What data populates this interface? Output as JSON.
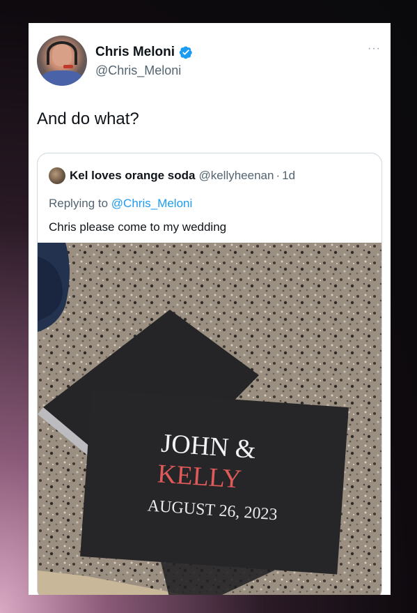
{
  "tweet": {
    "author_name": "Chris Meloni",
    "author_handle": "@Chris_Meloni",
    "more_label": "···",
    "text": "And do what?"
  },
  "quoted": {
    "author_name": "Kel loves orange soda",
    "author_handle": "@kellyheenan",
    "separator": "·",
    "time": "1d",
    "replying_prefix": "Replying to",
    "replying_mention": "@Chris_Meloni",
    "text": "Chris please come to my wedding",
    "photo": {
      "line1": "JOHN &",
      "line2": "KELLY",
      "date": "AUGUST 26, 2023"
    }
  },
  "colors": {
    "verified": "#1d9bf0",
    "link": "#1d9bf0",
    "secondary_text": "#536471",
    "card_accent_red": "#e05a5a"
  }
}
